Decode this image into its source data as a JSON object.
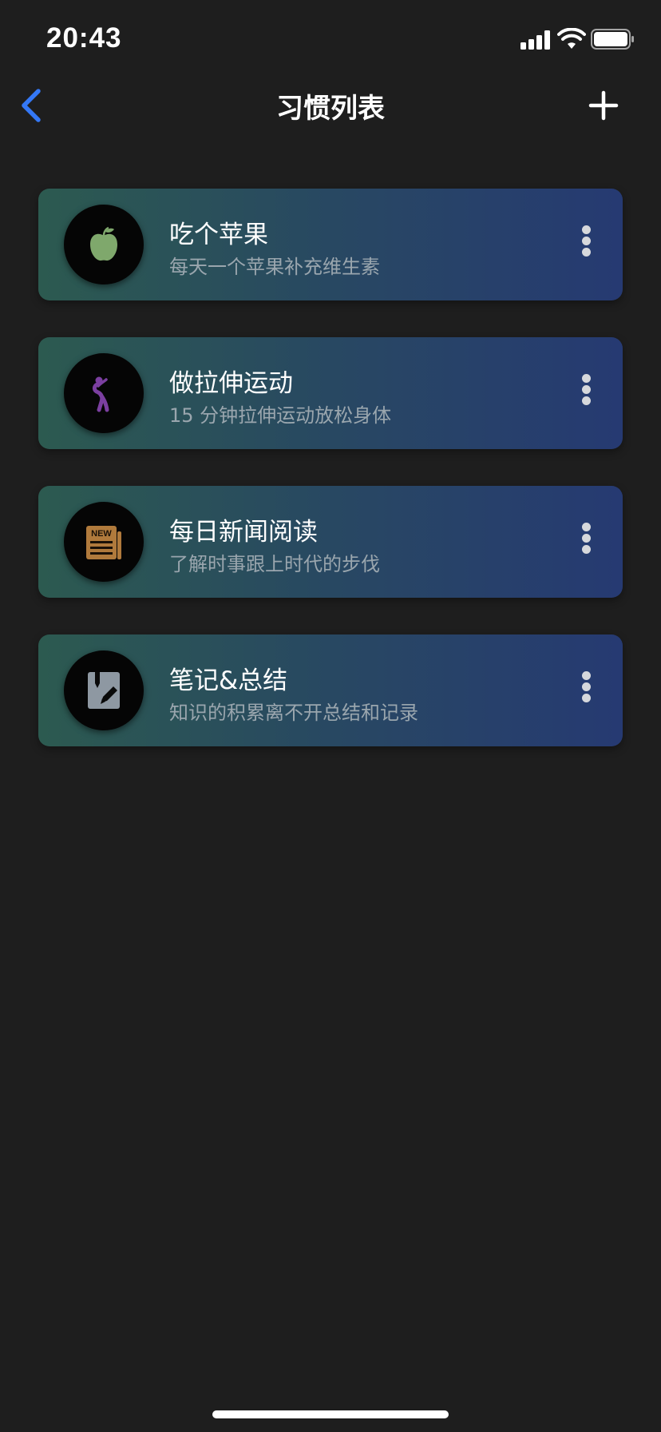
{
  "status_bar": {
    "time": "20:43",
    "icons": [
      "signal-icon",
      "wifi-icon",
      "battery-icon"
    ]
  },
  "nav": {
    "title": "习惯列表",
    "back_icon": "chevron-left-icon",
    "add_icon": "plus-icon",
    "accent_color": "#3478f6"
  },
  "habits": [
    {
      "title": "吃个苹果",
      "subtitle": "每天一个苹果补充维生素",
      "icon": "apple-icon",
      "icon_color": "#7fa86c"
    },
    {
      "title": "做拉伸运动",
      "subtitle": "15 分钟拉伸运动放松身体",
      "icon": "stretching-person-icon",
      "icon_color": "#7b3fa0"
    },
    {
      "title": "每日新闻阅读",
      "subtitle": "了解时事跟上时代的步伐",
      "icon": "newspaper-icon",
      "icon_label": "NEW",
      "icon_color": "#b07a3c"
    },
    {
      "title": "笔记&总结",
      "subtitle": "知识的积累离不开总结和记录",
      "icon": "notebook-pen-icon",
      "icon_color": "#8e98a2"
    }
  ],
  "colors": {
    "background": "#1e1e1e",
    "card_gradient_start": "#2c5a50",
    "card_gradient_end": "#263a72",
    "subtitle": "#9aa6ae"
  }
}
